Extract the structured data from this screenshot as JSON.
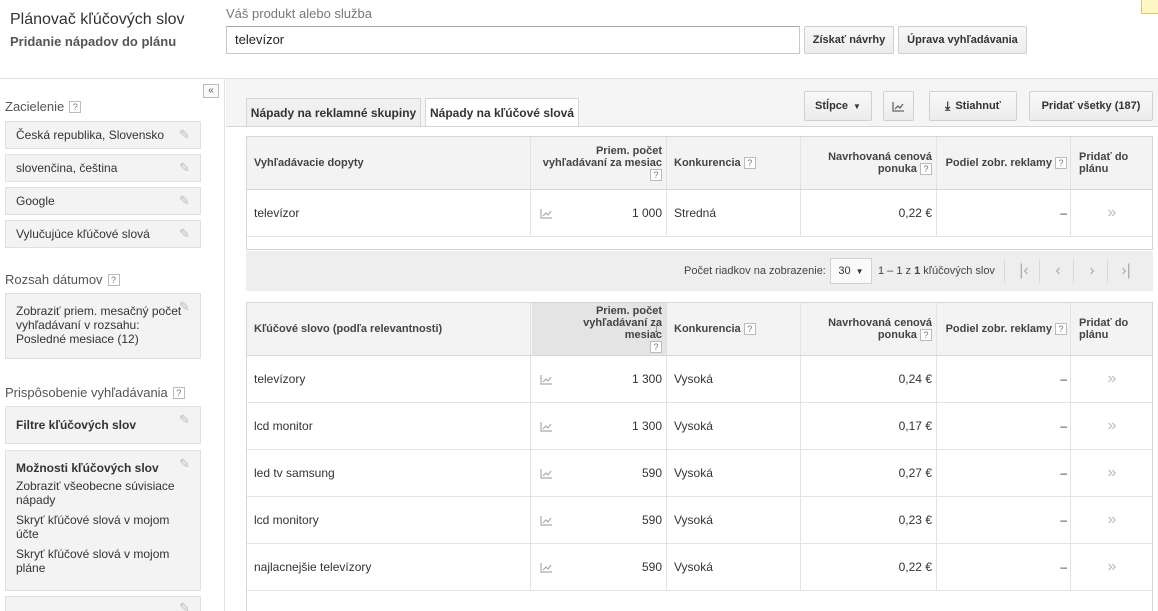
{
  "header": {
    "title": "Plánovač kľúčových slov",
    "subtitle": "Pridanie nápadov do plánu",
    "product_label": "Váš produkt alebo služba",
    "product_value": "televízor",
    "get_ideas_label": "Získať návrhy",
    "edit_search_label": "Úprava vyhľadávania"
  },
  "sidebar": {
    "collapse": "«",
    "targeting": {
      "title": "Zacielenie",
      "items": [
        "Česká republika, Slovensko",
        "slovenčina, čeština",
        "Google",
        "Vylučujúce kľúčové slová"
      ]
    },
    "date_range": {
      "title": "Rozsah dátumov",
      "text": "Zobraziť priem. mesačný počet vyhľadávaní v rozsahu: Posledné mesiace (12)"
    },
    "customize": {
      "title": "Prispôsobenie vyhľadávania",
      "filters_label": "Filtre kľúčových slov",
      "options_title": "Možnosti kľúčových slov",
      "options": [
        "Zobraziť všeobecne súvisiace nápady",
        "Skryť kľúčové slová v mojom účte",
        "Skryť kľúčové slová v mojom pláne"
      ]
    }
  },
  "tabs": [
    {
      "label": "Nápady na reklamné skupiny"
    },
    {
      "label": "Nápady na kľúčové slová"
    }
  ],
  "toolbar": {
    "columns_label": "Stĺpce",
    "download_label": "Stiahnuť",
    "add_all_label": "Pridať všetky (187)"
  },
  "search_table": {
    "headers": {
      "keyword": "Vyhľadávacie dopyty",
      "volume": "Priem. počet vyhľadávaní za mesiac",
      "competition": "Konkurencia",
      "bid": "Navrhovaná cenová ponuka",
      "share": "Podiel zobr. reklamy",
      "add": "Pridať do plánu"
    },
    "rows": [
      {
        "keyword": "televízor",
        "volume": "1 000",
        "competition": "Stredná",
        "bid": "0,22 €",
        "share": "–",
        "add": "»"
      }
    ]
  },
  "pagination": {
    "rows_label": "Počet riadkov na zobrazenie:",
    "rows_value": "30",
    "range_prefix": "1 – 1 z ",
    "range_count": "1",
    "range_suffix": " kľúčových slov"
  },
  "keyword_table": {
    "headers": {
      "keyword": "Kľúčové slovo (podľa relevantnosti)",
      "volume": "Priem. počet vyhľadávaní za mesiac",
      "competition": "Konkurencia",
      "bid": "Navrhovaná cenová ponuka",
      "share": "Podiel zobr. reklamy",
      "add": "Pridať do plánu"
    },
    "rows": [
      {
        "keyword": "televízory",
        "volume": "1 300",
        "competition": "Vysoká",
        "bid": "0,24 €",
        "share": "–",
        "add": "»"
      },
      {
        "keyword": "lcd monitor",
        "volume": "1 300",
        "competition": "Vysoká",
        "bid": "0,17 €",
        "share": "–",
        "add": "»"
      },
      {
        "keyword": "led tv samsung",
        "volume": "590",
        "competition": "Vysoká",
        "bid": "0,27 €",
        "share": "–",
        "add": "»"
      },
      {
        "keyword": "lcd monitory",
        "volume": "590",
        "competition": "Vysoká",
        "bid": "0,23 €",
        "share": "–",
        "add": "»"
      },
      {
        "keyword": "najlacnejšie televízory",
        "volume": "590",
        "competition": "Vysoká",
        "bid": "0,22 €",
        "share": "–",
        "add": "»"
      }
    ]
  }
}
